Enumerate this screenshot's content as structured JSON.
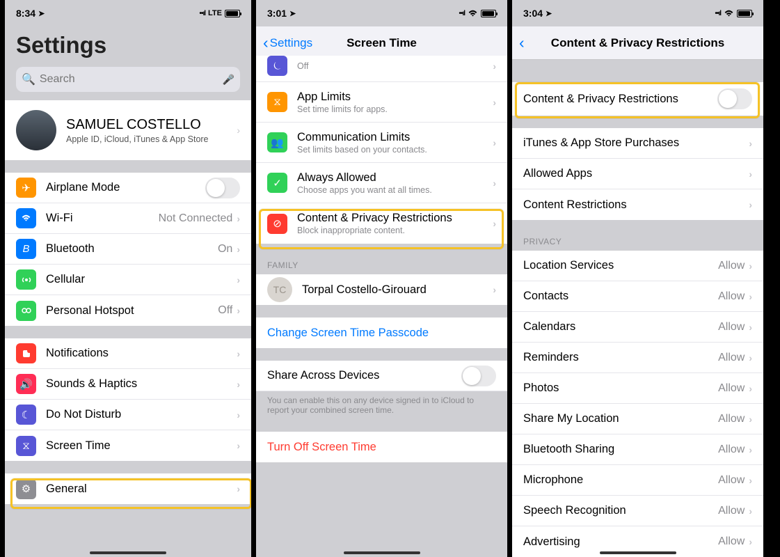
{
  "p1": {
    "time": "8:34",
    "network": "LTE",
    "title": "Settings",
    "search_ph": "Search",
    "profile_name": "SAMUEL COSTELLO",
    "profile_sub": "Apple ID, iCloud, iTunes & App Store",
    "g1": [
      {
        "l": "Airplane Mode",
        "c": "#ff9500",
        "g": "✈"
      },
      {
        "l": "Wi-Fi",
        "v": "Not Connected",
        "c": "#007aff"
      },
      {
        "l": "Bluetooth",
        "v": "On",
        "c": "#007aff",
        "g": "B"
      },
      {
        "l": "Cellular",
        "c": "#30d158"
      },
      {
        "l": "Personal Hotspot",
        "v": "Off",
        "c": "#30d158"
      }
    ],
    "g2": [
      {
        "l": "Notifications",
        "c": "#ff3b30"
      },
      {
        "l": "Sounds & Haptics",
        "c": "#ff2d55"
      },
      {
        "l": "Do Not Disturb",
        "c": "#5856d6",
        "g": "☽"
      },
      {
        "l": "Screen Time",
        "c": "#5856d6",
        "g": "⧖"
      }
    ],
    "g3": [
      {
        "l": "General",
        "c": "#8e8e93",
        "g": "⚙"
      }
    ]
  },
  "p2": {
    "time": "3:01",
    "back": "Settings",
    "title": "Screen Time",
    "rows": [
      {
        "l": "",
        "s": "Off",
        "c": "#5856d6"
      },
      {
        "l": "App Limits",
        "s": "Set time limits for apps.",
        "c": "#ff9500",
        "g": "⧖"
      },
      {
        "l": "Communication Limits",
        "s": "Set limits based on your contacts.",
        "c": "#30d158"
      },
      {
        "l": "Always Allowed",
        "s": "Choose apps you want at all times.",
        "c": "#30d158",
        "g": "✓"
      },
      {
        "l": "Content & Privacy Restrictions",
        "s": "Block inappropriate content.",
        "c": "#ff3b30",
        "g": "⃠"
      }
    ],
    "family_h": "FAMILY",
    "family_initials": "TC",
    "family_name": "Torpal Costello-Girouard",
    "change_passcode": "Change Screen Time Passcode",
    "share_across": "Share Across Devices",
    "share_footer": "You can enable this on any device signed in to iCloud to report your combined screen time.",
    "turn_off": "Turn Off Screen Time"
  },
  "p3": {
    "time": "3:04",
    "title": "Content & Privacy Restrictions",
    "main_toggle": "Content & Privacy Restrictions",
    "g1": [
      "iTunes & App Store Purchases",
      "Allowed Apps",
      "Content Restrictions"
    ],
    "privacy_h": "PRIVACY",
    "privacy": [
      {
        "l": "Location Services",
        "v": "Allow"
      },
      {
        "l": "Contacts",
        "v": "Allow"
      },
      {
        "l": "Calendars",
        "v": "Allow"
      },
      {
        "l": "Reminders",
        "v": "Allow"
      },
      {
        "l": "Photos",
        "v": "Allow"
      },
      {
        "l": "Share My Location",
        "v": "Allow"
      },
      {
        "l": "Bluetooth Sharing",
        "v": "Allow"
      },
      {
        "l": "Microphone",
        "v": "Allow"
      },
      {
        "l": "Speech Recognition",
        "v": "Allow"
      },
      {
        "l": "Advertising",
        "v": "Allow"
      }
    ]
  }
}
